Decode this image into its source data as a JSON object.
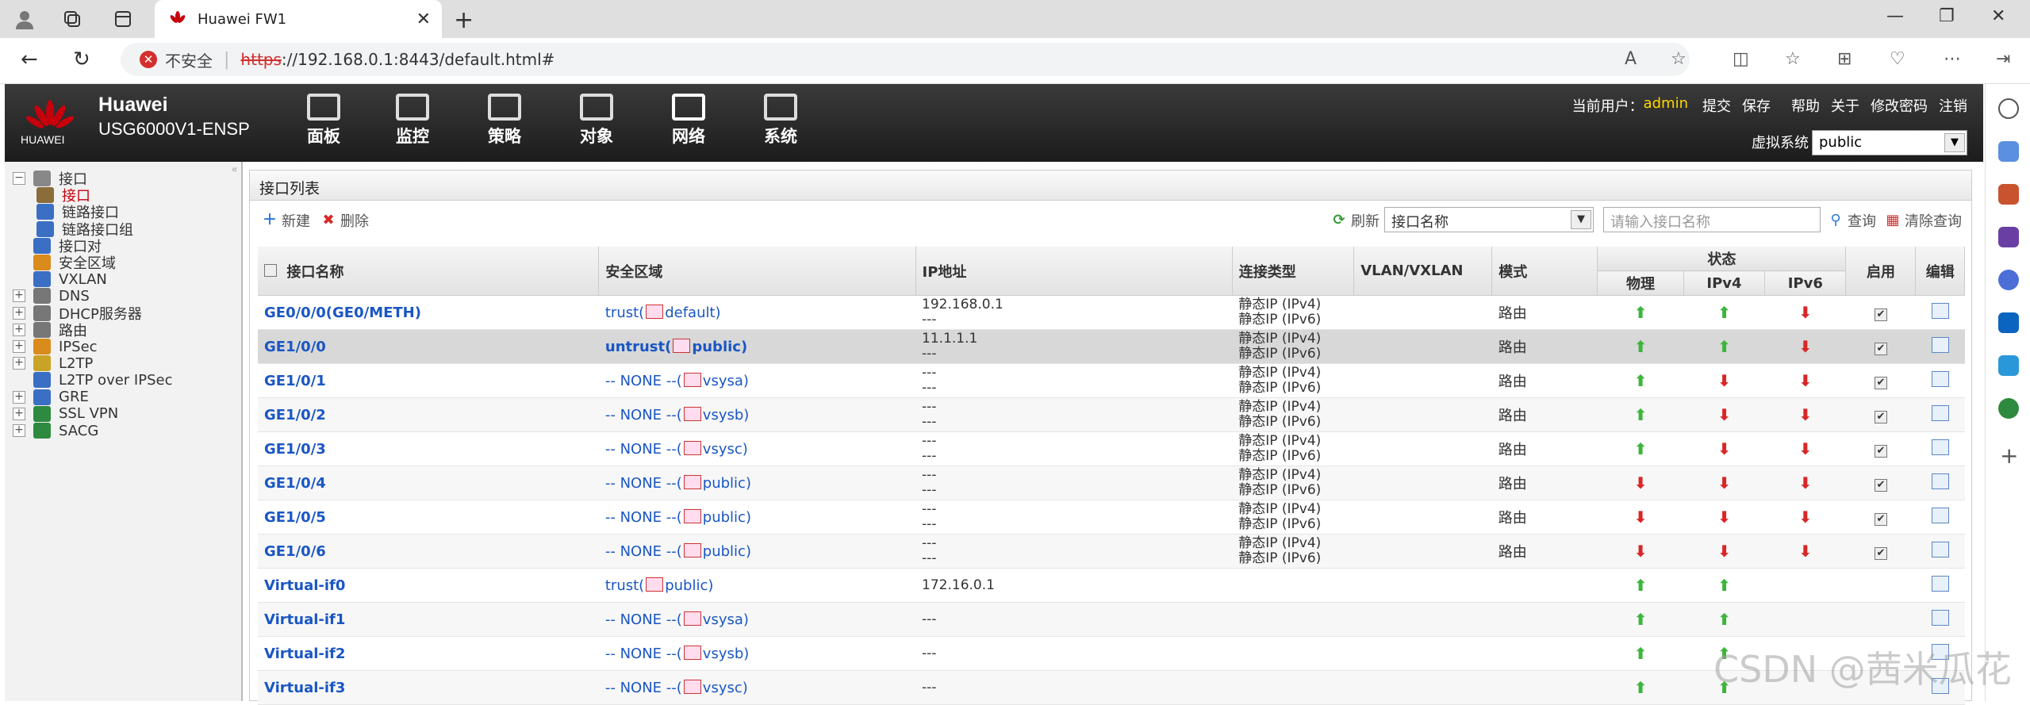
{
  "browser": {
    "tab_title": "Huawei FW1",
    "not_secure": "不安全",
    "url_scheme": "https",
    "url_rest": "://192.168.0.1:8443/default.html#"
  },
  "header": {
    "brand": "Huawei",
    "model": "USG6000V1-ENSP",
    "logo_text": "HUAWEI",
    "nav": [
      "面板",
      "监控",
      "策略",
      "对象",
      "网络",
      "系统"
    ],
    "current_user_label": "当前用户：",
    "current_user": "admin",
    "links": [
      "提交",
      "保存",
      "帮助",
      "关于",
      "修改密码",
      "注销"
    ],
    "vsys_label": "虚拟系统",
    "vsys_value": "public"
  },
  "sidebar": {
    "items": [
      {
        "label": "接口",
        "level": 0,
        "expander": "−"
      },
      {
        "label": "接口",
        "level": 1,
        "expander": ""
      },
      {
        "label": "链路接口",
        "level": 1,
        "expander": ""
      },
      {
        "label": "链路接口组",
        "level": 1,
        "expander": ""
      },
      {
        "label": "接口对",
        "level": 0,
        "expander": ""
      },
      {
        "label": "安全区域",
        "level": 0,
        "expander": ""
      },
      {
        "label": "VXLAN",
        "level": 0,
        "expander": ""
      },
      {
        "label": "DNS",
        "level": 0,
        "expander": "+"
      },
      {
        "label": "DHCP服务器",
        "level": 0,
        "expander": "+"
      },
      {
        "label": "路由",
        "level": 0,
        "expander": "+"
      },
      {
        "label": "IPSec",
        "level": 0,
        "expander": "+"
      },
      {
        "label": "L2TP",
        "level": 0,
        "expander": "+"
      },
      {
        "label": "L2TP over IPSec",
        "level": 0,
        "expander": ""
      },
      {
        "label": "GRE",
        "level": 0,
        "expander": "+"
      },
      {
        "label": "SSL VPN",
        "level": 0,
        "expander": "+"
      },
      {
        "label": "SACG",
        "level": 0,
        "expander": "+"
      }
    ]
  },
  "panel": {
    "title": "接口列表",
    "new_label": "新建",
    "delete_label": "删除",
    "refresh_label": "刷新",
    "filter_select": "接口名称",
    "filter_placeholder": "请输入接口名称",
    "query_label": "查询",
    "clear_label": "清除查询"
  },
  "table": {
    "headers": {
      "name": "接口名称",
      "zone": "安全区域",
      "ip": "IP地址",
      "conn": "连接类型",
      "vlan": "VLAN/VXLAN",
      "mode": "模式",
      "status": "状态",
      "phys": "物理",
      "ipv4": "IPv4",
      "ipv6": "IPv6",
      "enable": "启用",
      "edit": "编辑"
    },
    "rows": [
      {
        "name": "GE0/0/0(GE0/METH)",
        "zone": "trust(",
        "vsys": "default)",
        "ip1": "192.168.0.1",
        "ip2": "---",
        "c1": "静态IP (IPv4)",
        "c2": "静态IP (IPv6)",
        "mode": "路由",
        "phys": "up",
        "v4": "up",
        "v6": "down",
        "en": true
      },
      {
        "name": "GE1/0/0",
        "zone": "untrust(",
        "vsys": "public)",
        "ip1": "11.1.1.1",
        "ip2": "---",
        "c1": "静态IP (IPv4)",
        "c2": "静态IP (IPv6)",
        "mode": "路由",
        "phys": "up",
        "v4": "up",
        "v6": "down",
        "en": true
      },
      {
        "name": "GE1/0/1",
        "zone": "-- NONE --(",
        "vsys": "vsysa)",
        "ip1": "---",
        "ip2": "---",
        "c1": "静态IP (IPv4)",
        "c2": "静态IP (IPv6)",
        "mode": "路由",
        "phys": "up",
        "v4": "down",
        "v6": "down",
        "en": true
      },
      {
        "name": "GE1/0/2",
        "zone": "-- NONE --(",
        "vsys": "vsysb)",
        "ip1": "---",
        "ip2": "---",
        "c1": "静态IP (IPv4)",
        "c2": "静态IP (IPv6)",
        "mode": "路由",
        "phys": "up",
        "v4": "down",
        "v6": "down",
        "en": true
      },
      {
        "name": "GE1/0/3",
        "zone": "-- NONE --(",
        "vsys": "vsysc)",
        "ip1": "---",
        "ip2": "---",
        "c1": "静态IP (IPv4)",
        "c2": "静态IP (IPv6)",
        "mode": "路由",
        "phys": "up",
        "v4": "down",
        "v6": "down",
        "en": true
      },
      {
        "name": "GE1/0/4",
        "zone": "-- NONE --(",
        "vsys": "public)",
        "ip1": "---",
        "ip2": "---",
        "c1": "静态IP (IPv4)",
        "c2": "静态IP (IPv6)",
        "mode": "路由",
        "phys": "down",
        "v4": "down",
        "v6": "down",
        "en": true
      },
      {
        "name": "GE1/0/5",
        "zone": "-- NONE --(",
        "vsys": "public)",
        "ip1": "---",
        "ip2": "---",
        "c1": "静态IP (IPv4)",
        "c2": "静态IP (IPv6)",
        "mode": "路由",
        "phys": "down",
        "v4": "down",
        "v6": "down",
        "en": true
      },
      {
        "name": "GE1/0/6",
        "zone": "-- NONE --(",
        "vsys": "public)",
        "ip1": "---",
        "ip2": "---",
        "c1": "静态IP (IPv4)",
        "c2": "静态IP (IPv6)",
        "mode": "路由",
        "phys": "down",
        "v4": "down",
        "v6": "down",
        "en": true
      },
      {
        "name": "Virtual-if0",
        "zone": "trust(",
        "vsys": "public)",
        "ip1": "172.16.0.1",
        "ip2": "",
        "c1": "",
        "c2": "",
        "mode": "",
        "phys": "up",
        "v4": "up",
        "v6": "",
        "en": false
      },
      {
        "name": "Virtual-if1",
        "zone": "-- NONE --(",
        "vsys": "vsysa)",
        "ip1": "---",
        "ip2": "",
        "c1": "",
        "c2": "",
        "mode": "",
        "phys": "up",
        "v4": "up",
        "v6": "",
        "en": false
      },
      {
        "name": "Virtual-if2",
        "zone": "-- NONE --(",
        "vsys": "vsysb)",
        "ip1": "---",
        "ip2": "",
        "c1": "",
        "c2": "",
        "mode": "",
        "phys": "up",
        "v4": "up",
        "v6": "",
        "en": false
      },
      {
        "name": "Virtual-if3",
        "zone": "-- NONE --(",
        "vsys": "vsysc)",
        "ip1": "---",
        "ip2": "",
        "c1": "",
        "c2": "",
        "mode": "",
        "phys": "up",
        "v4": "up",
        "v6": "",
        "en": false
      }
    ]
  },
  "watermark": "CSDN @茜米瓜花",
  "colors": {
    "accent_red": "#c7000b",
    "link_blue": "#1a56c4",
    "status_up": "#3db53d",
    "status_down": "#d92626"
  }
}
